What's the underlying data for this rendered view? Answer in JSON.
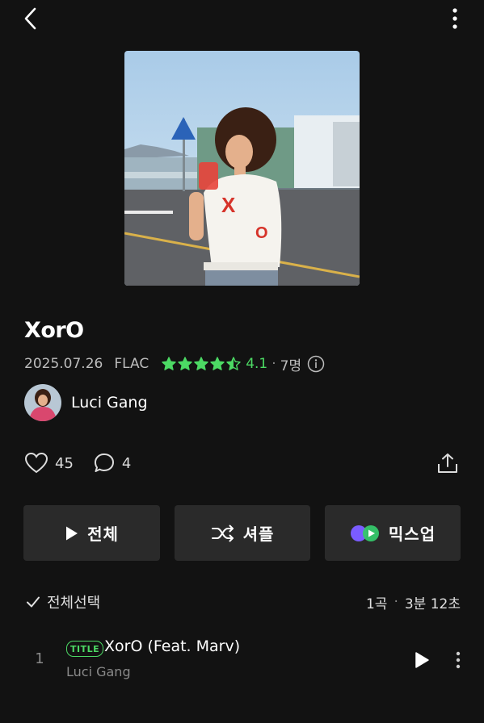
{
  "album": {
    "title": "XorO",
    "release_date": "2025.07.26",
    "format": "FLAC",
    "rating": "4.1",
    "rating_stars": 4.5,
    "rating_count": "7명"
  },
  "artist": {
    "name": "Luci Gang"
  },
  "social": {
    "likes": "45",
    "comments": "4"
  },
  "actions": {
    "play_all_label": "전체",
    "shuffle_label": "셔플",
    "mixup_label": "믹스업"
  },
  "tracklist": {
    "select_all_label": "전체선택",
    "count": "1곡",
    "duration": "3분 12초",
    "tracks": [
      {
        "number": "1",
        "badge": "TITLE",
        "title": "XorO (Feat. Marv)",
        "artist": "Luci Gang"
      }
    ]
  },
  "colors": {
    "background": "#121212",
    "accent_green": "#4cd964",
    "button_bg": "#2a2a2a"
  },
  "icons": {
    "back": "chevron-left-icon",
    "more": "more-vertical-icon",
    "info": "info-icon",
    "like": "heart-icon",
    "comment": "comment-icon",
    "share": "share-icon",
    "play": "play-icon",
    "shuffle": "shuffle-icon",
    "mixup": "mixup-icon",
    "check": "check-icon"
  }
}
